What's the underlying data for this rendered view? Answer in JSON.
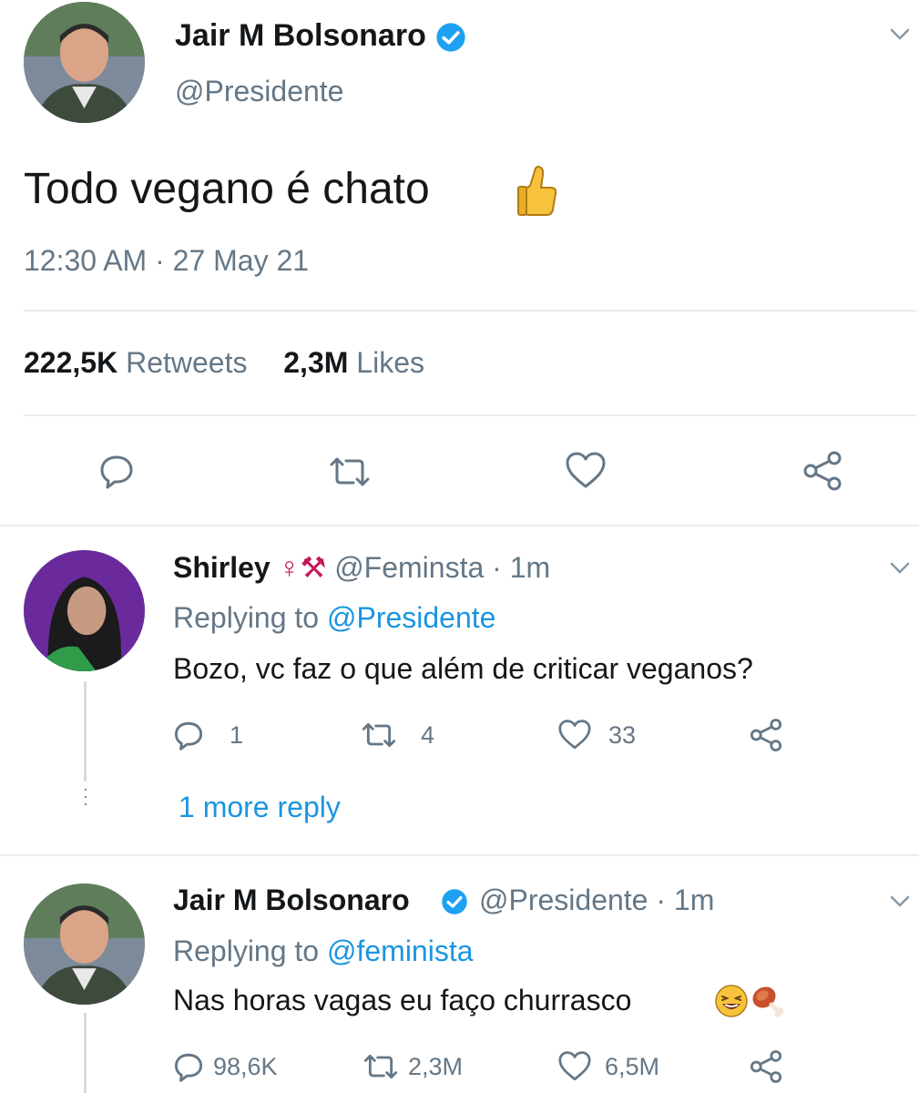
{
  "main_tweet": {
    "author_name": "Jair M Bolsonaro",
    "handle": "@Presidente",
    "text": "Todo vegano é chato",
    "emoji": "thumbs-up",
    "timestamp": "12:30 AM · 27 May 21",
    "retweets_count": "222,5K",
    "retweets_label": "Retweets",
    "likes_count": "2,3M",
    "likes_label": "Likes"
  },
  "reply_1": {
    "author_name": "Shirley",
    "author_emojis": "♀⚒",
    "handle": "@Feminsta",
    "time": "· 1m",
    "replying_prefix": "Replying to",
    "replying_to": "@Presidente",
    "text": "Bozo, vc faz o que além de criticar veganos?",
    "reply_count": "1",
    "retweet_count": "4",
    "like_count": "33",
    "more_replies": "1 more reply"
  },
  "reply_2": {
    "author_name": "Jair M Bolsonaro",
    "handle": "@Presidente",
    "time": "· 1m",
    "replying_prefix": "Replying to",
    "replying_to": "@feminista",
    "text": "Nas horas vagas eu faço churrasco",
    "reply_count": "98,6K",
    "retweet_count": "2,3M",
    "like_count": "6,5M"
  },
  "colors": {
    "verified": "#1da1f2",
    "link_blue": "#1b95e0",
    "gray_text": "#657786",
    "divider": "#e6ecf0"
  }
}
